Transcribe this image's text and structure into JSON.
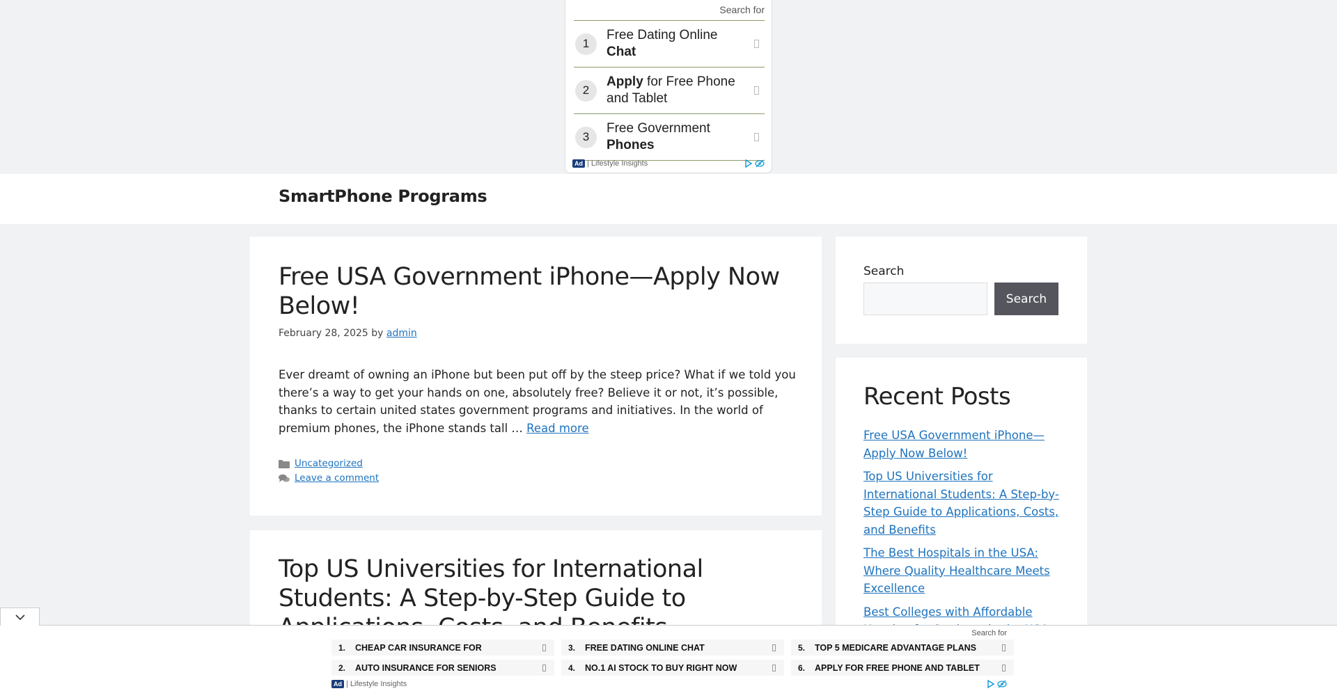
{
  "top_ad": {
    "search_for": "Search for",
    "items": [
      {
        "num": "1",
        "pre": "Free Dating Online ",
        "bold": "Chat",
        "post": ""
      },
      {
        "num": "2",
        "pre": "",
        "bold": "Apply",
        "post": " for Free Phone and Tablet"
      },
      {
        "num": "3",
        "pre": "Free Government ",
        "bold": "Phones",
        "post": ""
      }
    ],
    "badge": "Ad",
    "provider": "| Lifestyle Insights"
  },
  "header": {
    "site_title": "SmartPhone Programs"
  },
  "posts": [
    {
      "title": "Free USA Government iPhone—Apply Now Below!",
      "date": "February 28, 2025",
      "by": " by ",
      "author": "admin",
      "excerpt": "Ever dreamt of owning an iPhone but been put off by the steep price? What if we told you there’s a way to get your hands on one, absolutely free? Believe it or not, it’s possible, thanks to certain united states government programs and initiatives. In the world of premium phones, the iPhone stands tall … ",
      "read_more": "Read more",
      "category": "Uncategorized",
      "comment": "Leave a comment"
    },
    {
      "title": "Top US Universities for International Students: A Step-by-Step Guide to Applications, Costs, and Benefits"
    }
  ],
  "sidebar": {
    "search_label": "Search",
    "search_button": "Search",
    "recent_title": "Recent Posts",
    "recent": [
      "Free USA Government iPhone—Apply Now Below!",
      "Top US Universities for International Students: A Step-by-Step Guide to Applications, Costs, and Benefits",
      "The Best Hospitals in the USA: Where Quality Healthcare Meets Excellence",
      "Best Colleges with Affordable Housing for Students in the USA"
    ]
  },
  "bottom_ad": {
    "search_for": "Search for",
    "items": [
      {
        "num": "1.",
        "text": "CHEAP CAR INSURANCE FOR"
      },
      {
        "num": "3.",
        "text": "FREE DATING ONLINE CHAT"
      },
      {
        "num": "5.",
        "text": "TOP 5 MEDICARE ADVANTAGE PLANS"
      },
      {
        "num": "2.",
        "text": "AUTO INSURANCE FOR SENIORS"
      },
      {
        "num": "4.",
        "text": "NO.1 AI STOCK TO BUY RIGHT NOW"
      },
      {
        "num": "6.",
        "text": "APPLY FOR FREE PHONE AND TABLET"
      }
    ],
    "badge": "Ad",
    "provider": "| Lifestyle Insights"
  },
  "colors": {
    "link": "#1e73be",
    "button": "#55555e",
    "ad_badge": "#1a3d7a",
    "adchoices": "#1a9bd7"
  }
}
